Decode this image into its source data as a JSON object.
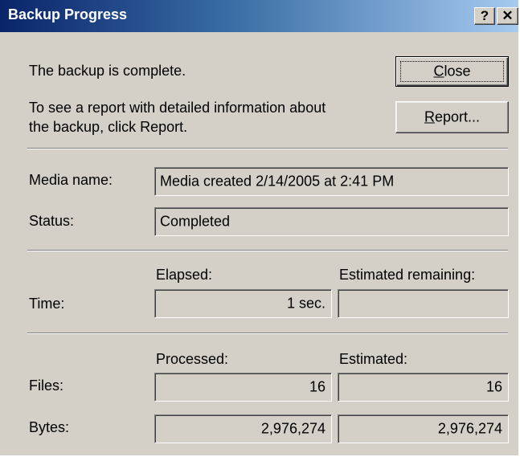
{
  "window": {
    "title": "Backup Progress",
    "help_button": "?",
    "close_button": "✕"
  },
  "message": {
    "complete": "The backup is complete.",
    "report_hint_line1": "To see a report with detailed information about",
    "report_hint_line2": "the backup, click Report."
  },
  "buttons": {
    "close_mnemonic": "C",
    "close_rest": "lose",
    "report_mnemonic": "R",
    "report_rest": "eport..."
  },
  "media": {
    "label": "Media name:",
    "value": "Media created 2/14/2005 at 2:41 PM"
  },
  "status": {
    "label": "Status:",
    "value": "Completed"
  },
  "time": {
    "label": "Time:",
    "elapsed_header": "Elapsed:",
    "remaining_header": "Estimated remaining:",
    "elapsed_value": "1 sec.",
    "remaining_value": ""
  },
  "counts": {
    "processed_header": "Processed:",
    "estimated_header": "Estimated:",
    "files_label": "Files:",
    "files_processed": "16",
    "files_estimated": "16",
    "bytes_label": "Bytes:",
    "bytes_processed": "2,976,274",
    "bytes_estimated": "2,976,274"
  },
  "colors": {
    "face": "#d4d0c8",
    "title_start": "#0a246a",
    "title_end": "#a6caf0"
  }
}
